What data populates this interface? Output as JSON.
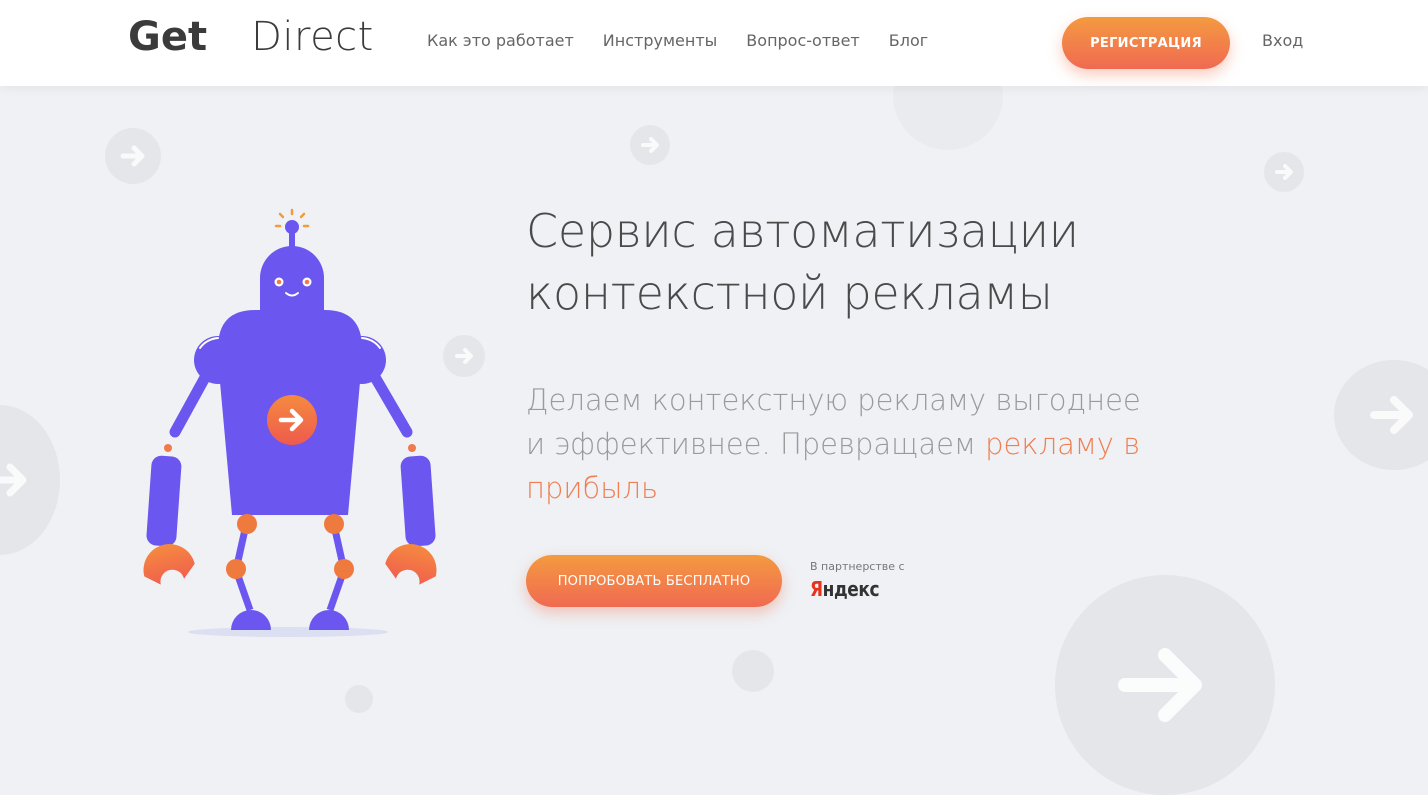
{
  "header": {
    "logo_part1": "Get",
    "logo_part2": "Direct",
    "nav": [
      {
        "label": "Как это работает"
      },
      {
        "label": "Инструменты"
      },
      {
        "label": "Вопрос-ответ"
      },
      {
        "label": "Блог"
      }
    ],
    "register_label": "РЕГИСТРАЦИЯ",
    "login_label": "Вход"
  },
  "hero": {
    "title_line1": "Сервис автоматизации",
    "title_line2": "контекстной рекламы",
    "subtitle_line1": "Делаем контекстную рекламу выгоднее",
    "subtitle_line2": "и эффективнее. Превращаем",
    "subtitle_accent_line2": "рекламу в",
    "subtitle_accent_line3": "прибыль",
    "cta_label": "ПОПРОБОВАТЬ БЕСПЛАТНО",
    "partner_label": "В партнерстве с",
    "partner_logo_first": "Я",
    "partner_logo_rest": "ндекс"
  },
  "colors": {
    "accent_orange": "#f06a52",
    "robot_purple": "#6b56f0",
    "background": "#eff1f5"
  },
  "icons": [
    "arrow-right-icon",
    "robot-mascot-icon",
    "arrow-bubble-icon"
  ]
}
